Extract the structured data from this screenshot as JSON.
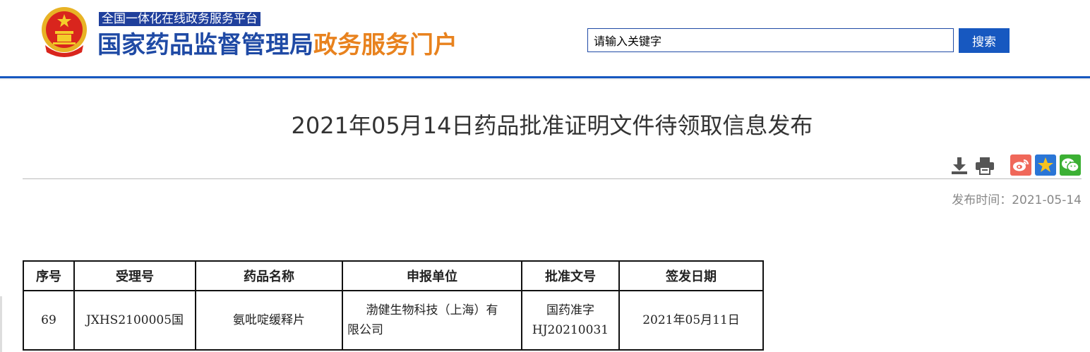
{
  "header": {
    "platform_label": "全国一体化在线政务服务平台",
    "title_blue": "国家药品监督管理局",
    "title_orange": "政务服务门户",
    "emblem": "national-emblem-icon"
  },
  "search": {
    "value": "请输入关键字",
    "button_label": "搜索"
  },
  "article": {
    "title": "2021年05月14日药品批准证明文件待领取信息发布",
    "publish_label": "发布时间：",
    "publish_date": "2021-05-14"
  },
  "tools": [
    {
      "name": "download-icon"
    },
    {
      "name": "print-icon"
    }
  ],
  "share": [
    {
      "name": "weibo-icon",
      "color": "#f0685a"
    },
    {
      "name": "favorite-star-icon",
      "color": "#2b76d6"
    },
    {
      "name": "wechat-icon",
      "color": "#3cb034"
    }
  ],
  "table": {
    "headers": [
      "序号",
      "受理号",
      "药品名称",
      "申报单位",
      "批准文号",
      "签发日期"
    ],
    "rows": [
      {
        "index": "69",
        "acceptance_no": "JXHS2100005国",
        "drug_name": "氨吡啶缓释片",
        "applicant_line1": "渤健生物科技（上海）有",
        "applicant_line2": "限公司",
        "approval_line1": "国药准字",
        "approval_line2": "HJ20210031",
        "issue_date": "2021年05月11日"
      }
    ]
  },
  "colors": {
    "brand_blue": "#1f4aa5",
    "brand_orange": "#e8821e",
    "button_blue": "#1758c0"
  }
}
